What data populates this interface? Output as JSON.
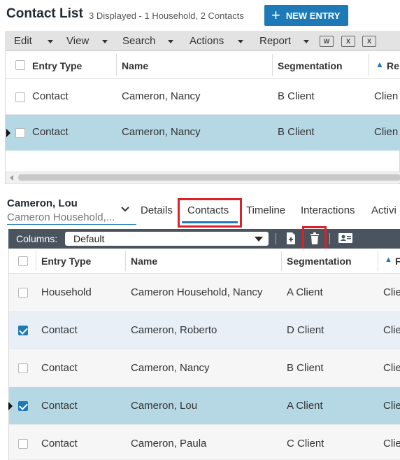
{
  "header": {
    "title": "Contact List",
    "subtitle": "3 Displayed - 1 Household, 2 Contacts",
    "new_entry_label": "NEW ENTRY",
    "accent": "#1d7ab7"
  },
  "toolbar": {
    "items": [
      "Edit",
      "View",
      "Search",
      "Actions",
      "Report"
    ],
    "office_icons": [
      "word-icon",
      "excel-icon",
      "excel-mailmerge-icon"
    ]
  },
  "top_grid": {
    "columns": [
      "Entry Type",
      "Name",
      "Segmentation",
      "Re"
    ],
    "rows": [
      {
        "type": "Contact",
        "name": "Cameron, Nancy",
        "segmentation": "B Client",
        "extra": "Clien",
        "selected": false
      },
      {
        "type": "Contact",
        "name": "Cameron, Nancy",
        "segmentation": "B Client",
        "extra": "Clien",
        "selected": true
      }
    ]
  },
  "detail": {
    "name": "Cameron, Lou",
    "household": "Cameron Household,...",
    "tabs": [
      "Details",
      "Contacts",
      "Timeline",
      "Interactions",
      "Activi"
    ],
    "active_tab": "Contacts"
  },
  "columns_toolbar": {
    "label": "Columns:",
    "selected": "Default"
  },
  "lower_grid": {
    "columns": [
      "Entry Type",
      "Name",
      "Segmentation",
      "F"
    ],
    "rows": [
      {
        "type": "Household",
        "name": "Cameron Household, Nancy",
        "segmentation": "A Client",
        "extra": "Clie",
        "checked": false,
        "current": false,
        "bg": "#f6f6f6"
      },
      {
        "type": "Contact",
        "name": "Cameron, Roberto",
        "segmentation": "D Client",
        "extra": "Clie",
        "checked": true,
        "current": false,
        "bg": "#e9eff7"
      },
      {
        "type": "Contact",
        "name": "Cameron, Nancy",
        "segmentation": "B Client",
        "extra": "Clie",
        "checked": false,
        "current": false,
        "bg": "#f6f6f6"
      },
      {
        "type": "Contact",
        "name": "Cameron, Lou",
        "segmentation": "A Client",
        "extra": "Clie",
        "checked": true,
        "current": true,
        "bg": "#b5d8e4"
      },
      {
        "type": "Contact",
        "name": "Cameron, Paula",
        "segmentation": "C Client",
        "extra": "Clie",
        "checked": false,
        "current": false,
        "bg": "#f6f6f6"
      }
    ]
  }
}
